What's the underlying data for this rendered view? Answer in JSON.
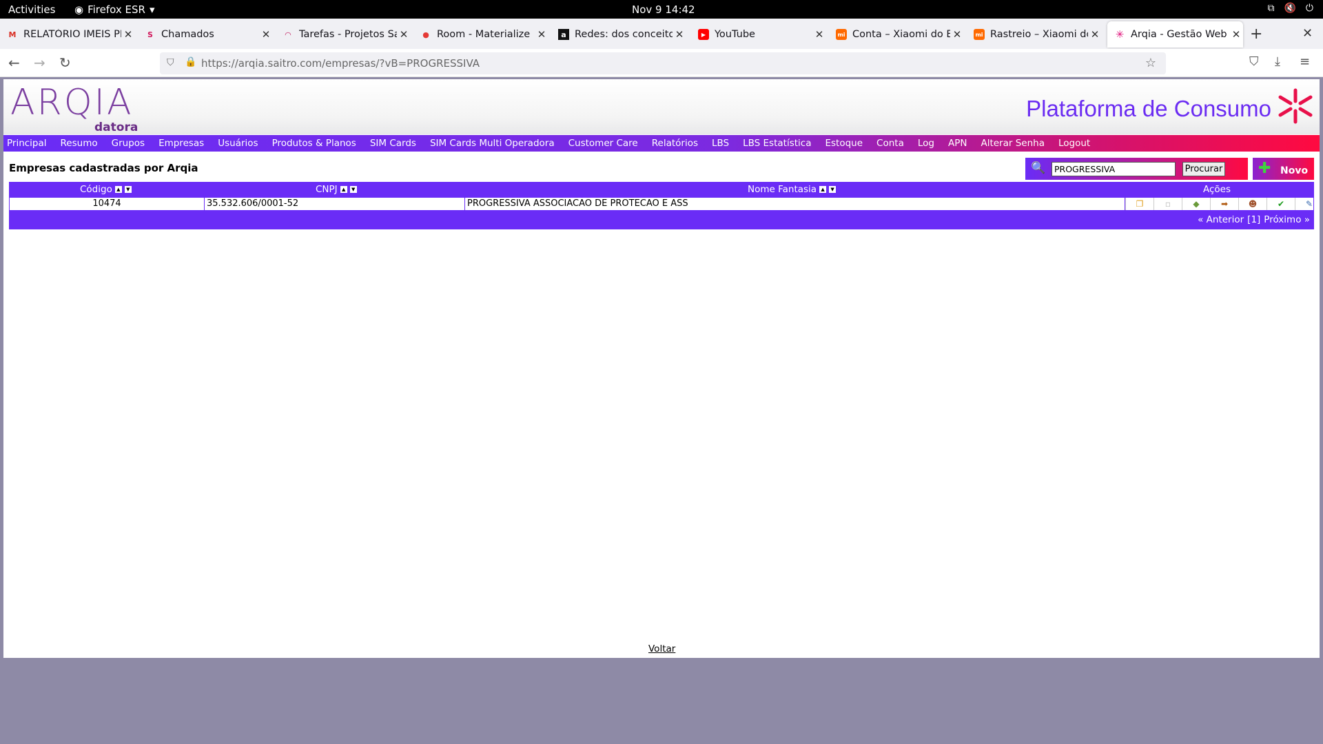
{
  "os": {
    "activities": "Activities",
    "app": "Firefox ESR",
    "clock": "Nov 9  14:42"
  },
  "tabs": [
    {
      "title": "RELATÓRIO IMEIS PR",
      "icon": "gmail-icon"
    },
    {
      "title": "Chamados",
      "icon": "saitro-icon"
    },
    {
      "title": "Tarefas - Projetos Sai",
      "icon": "tasks-icon"
    },
    {
      "title": "Room - Materialize",
      "icon": "room-icon"
    },
    {
      "title": "Redes: dos conceitos",
      "icon": "amazon-icon"
    },
    {
      "title": "YouTube",
      "icon": "youtube-icon"
    },
    {
      "title": "Conta – Xiaomi do Br",
      "icon": "xiaomi-icon"
    },
    {
      "title": "Rastreio – Xiaomi do",
      "icon": "xiaomi-icon"
    },
    {
      "title": "Arqia - Gestão Web",
      "icon": "arqia-icon"
    }
  ],
  "url": "https://arqia.saitro.com/empresas/?vB=PROGRESSIVA",
  "logo": {
    "main": "ARQIA",
    "sub": "datora"
  },
  "platform_title": "Plataforma de Consumo",
  "menu": [
    "Principal",
    "Resumo",
    "Grupos",
    "Empresas",
    "Usuários",
    "Produtos & Planos",
    "SIM Cards",
    "SIM Cards Multi Operadora",
    "Customer Care",
    "Relatórios",
    "LBS",
    "LBS Estatística",
    "Estoque",
    "Conta",
    "Log",
    "APN",
    "Alterar Senha",
    "Logout"
  ],
  "heading": "Empresas cadastradas por Arqia",
  "search": {
    "value": "PROGRESSIVA",
    "button": "Procurar"
  },
  "novo": "Novo",
  "table": {
    "headers": {
      "codigo": "Código",
      "cnpj": "CNPJ",
      "nome": "Nome Fantasia",
      "acoes": "Ações"
    },
    "rows": [
      {
        "codigo": "10474",
        "cnpj": "35.532.606/0001-52",
        "nome": "PROGRESSIVA ASSOCIACAO DE PROTECAO E ASS"
      }
    ],
    "action_icons": [
      "copy-icon",
      "document-icon",
      "tag-icon",
      "transfer-icon",
      "users-icon",
      "check-icon",
      "edit-icon"
    ]
  },
  "pager": {
    "prev": "« Anterior",
    "current": "[1]",
    "next": "Próximo »"
  },
  "footer": {
    "voltar": "Voltar"
  },
  "colors": {
    "purple": "#6a2cf6",
    "red": "#ff0a40",
    "bg": "#8e8aa6"
  }
}
